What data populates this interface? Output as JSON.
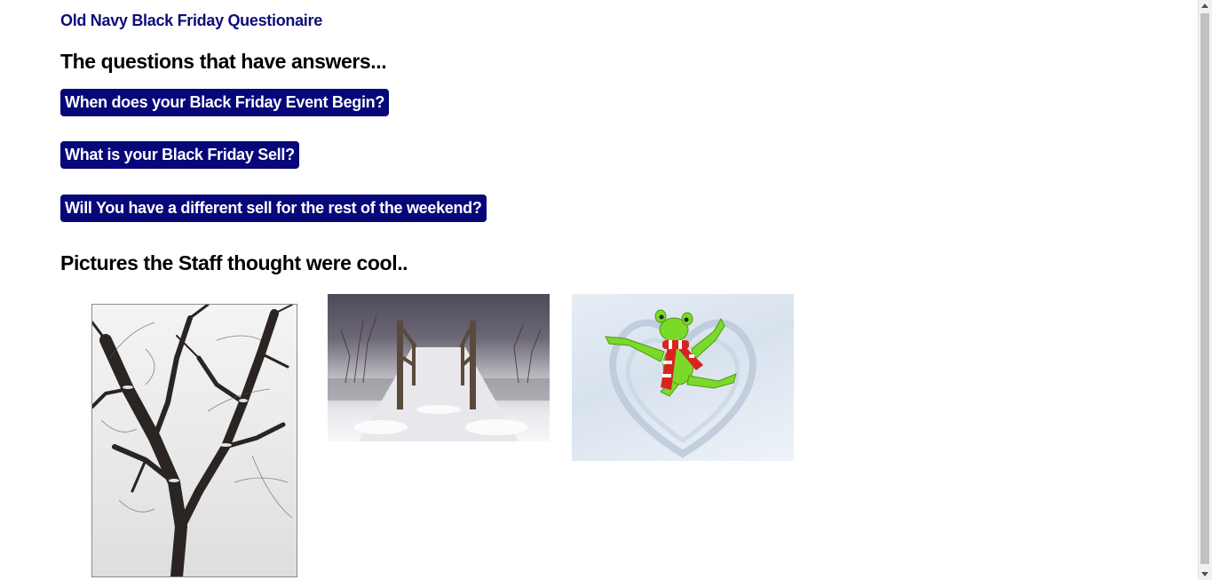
{
  "site": {
    "title": "Old Navy Black Friday Questionaire"
  },
  "questions_section": {
    "heading": "The questions that have answers...",
    "buttons": [
      {
        "label": "When does your Black Friday Event Begin?"
      },
      {
        "label": "What is your Black Friday Sell?"
      },
      {
        "label": "Will You have a different sell for the rest of the weekend?"
      }
    ]
  },
  "pictures_section": {
    "heading": "Pictures the Staff thought were cool..",
    "images": [
      {
        "subject": "snow-covered-tree"
      },
      {
        "subject": "snowy-wooden-bridge"
      },
      {
        "subject": "green-frog-snow-angel"
      }
    ]
  },
  "colors": {
    "title": "#0d0d7a",
    "button_bg": "#07077a",
    "button_text": "#ffffff",
    "heading": "#000000",
    "background": "#ffffff"
  }
}
